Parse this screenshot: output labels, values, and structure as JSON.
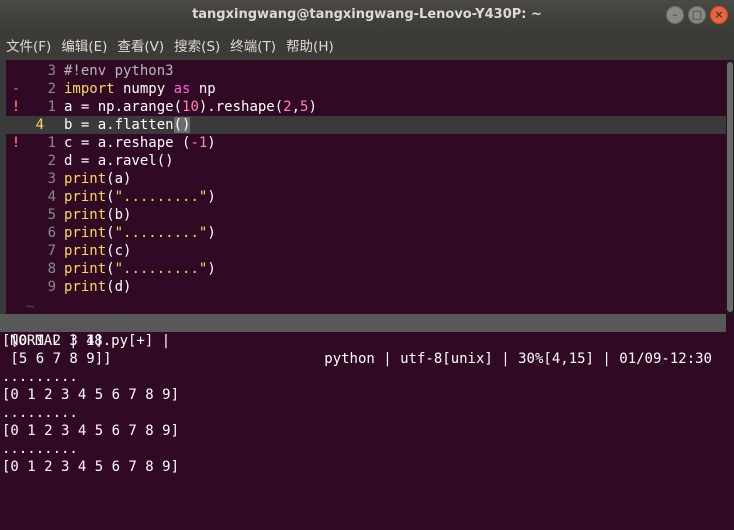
{
  "window": {
    "title": "tangxingwang@tangxingwang-Lenovo-Y430P: ~",
    "buttons": {
      "minimize": "–",
      "maximize": "□",
      "close": "×"
    }
  },
  "menu": [
    "文件(F)",
    "编辑(E)",
    "查看(V)",
    "搜索(S)",
    "终端(T)",
    "帮助(H)"
  ],
  "editor": {
    "lines": [
      {
        "sign": "",
        "num": "3",
        "parts": [
          {
            "t": "#!env python3",
            "c": "cmt"
          }
        ]
      },
      {
        "sign": "-",
        "num": "2",
        "parts": [
          {
            "t": "import",
            "c": "kw"
          },
          {
            "t": " numpy ",
            "c": ""
          },
          {
            "t": "as",
            "c": "kw2"
          },
          {
            "t": " np",
            "c": ""
          }
        ]
      },
      {
        "sign": "!",
        "num": "1",
        "parts": [
          {
            "t": "a = np.arange(",
            "c": ""
          },
          {
            "t": "10",
            "c": "numlit"
          },
          {
            "t": ").reshape(",
            "c": ""
          },
          {
            "t": "2",
            "c": "numlit"
          },
          {
            "t": ",",
            "c": ""
          },
          {
            "t": "5",
            "c": "numlit"
          },
          {
            "t": ")",
            "c": ""
          }
        ]
      },
      {
        "sign": "",
        "num": "4",
        "current": true,
        "parts": [
          {
            "t": "b = a.flatten",
            "c": ""
          },
          {
            "t": "()",
            "c": "bracket"
          }
        ]
      },
      {
        "sign": "!",
        "num": "1",
        "parts": [
          {
            "t": "c = a.reshape (",
            "c": ""
          },
          {
            "t": "-1",
            "c": "numlit"
          },
          {
            "t": ")",
            "c": ""
          }
        ]
      },
      {
        "sign": "",
        "num": "2",
        "parts": [
          {
            "t": "d = a.ravel()",
            "c": ""
          }
        ]
      },
      {
        "sign": "",
        "num": "3",
        "parts": [
          {
            "t": "print",
            "c": "kw"
          },
          {
            "t": "(a)",
            "c": ""
          }
        ]
      },
      {
        "sign": "",
        "num": "4",
        "parts": [
          {
            "t": "print",
            "c": "kw"
          },
          {
            "t": "(",
            "c": ""
          },
          {
            "t": "\".........\"",
            "c": "str"
          },
          {
            "t": ")",
            "c": ""
          }
        ]
      },
      {
        "sign": "",
        "num": "5",
        "parts": [
          {
            "t": "print",
            "c": "kw"
          },
          {
            "t": "(b)",
            "c": ""
          }
        ]
      },
      {
        "sign": "",
        "num": "6",
        "parts": [
          {
            "t": "print",
            "c": "kw"
          },
          {
            "t": "(",
            "c": ""
          },
          {
            "t": "\".........\"",
            "c": "str"
          },
          {
            "t": ")",
            "c": ""
          }
        ]
      },
      {
        "sign": "",
        "num": "7",
        "parts": [
          {
            "t": "print",
            "c": "kw"
          },
          {
            "t": "(c)",
            "c": ""
          }
        ]
      },
      {
        "sign": "",
        "num": "8",
        "parts": [
          {
            "t": "print",
            "c": "kw"
          },
          {
            "t": "(",
            "c": ""
          },
          {
            "t": "\".........\"",
            "c": "str"
          },
          {
            "t": ")",
            "c": ""
          }
        ]
      },
      {
        "sign": "",
        "num": "9",
        "parts": [
          {
            "t": "print",
            "c": "kw"
          },
          {
            "t": "(d)",
            "c": ""
          }
        ]
      }
    ],
    "tilde": "~"
  },
  "status": {
    "left": "NORMAL | 18.py[+] |",
    "right": "python | utf-8[unix] | 30%[4,15] | 01/09-12:30"
  },
  "output": [
    "[[0 1 2 3 4]",
    " [5 6 7 8 9]]",
    ".........",
    "[0 1 2 3 4 5 6 7 8 9]",
    ".........",
    "[0 1 2 3 4 5 6 7 8 9]",
    ".........",
    "[0 1 2 3 4 5 6 7 8 9]"
  ],
  "colors": {
    "terminal_bg": "#300a24",
    "keyword": "#ffd75f",
    "keyword_as": "#ff5fd7",
    "number": "#ff87af",
    "statusline": "#585858"
  }
}
